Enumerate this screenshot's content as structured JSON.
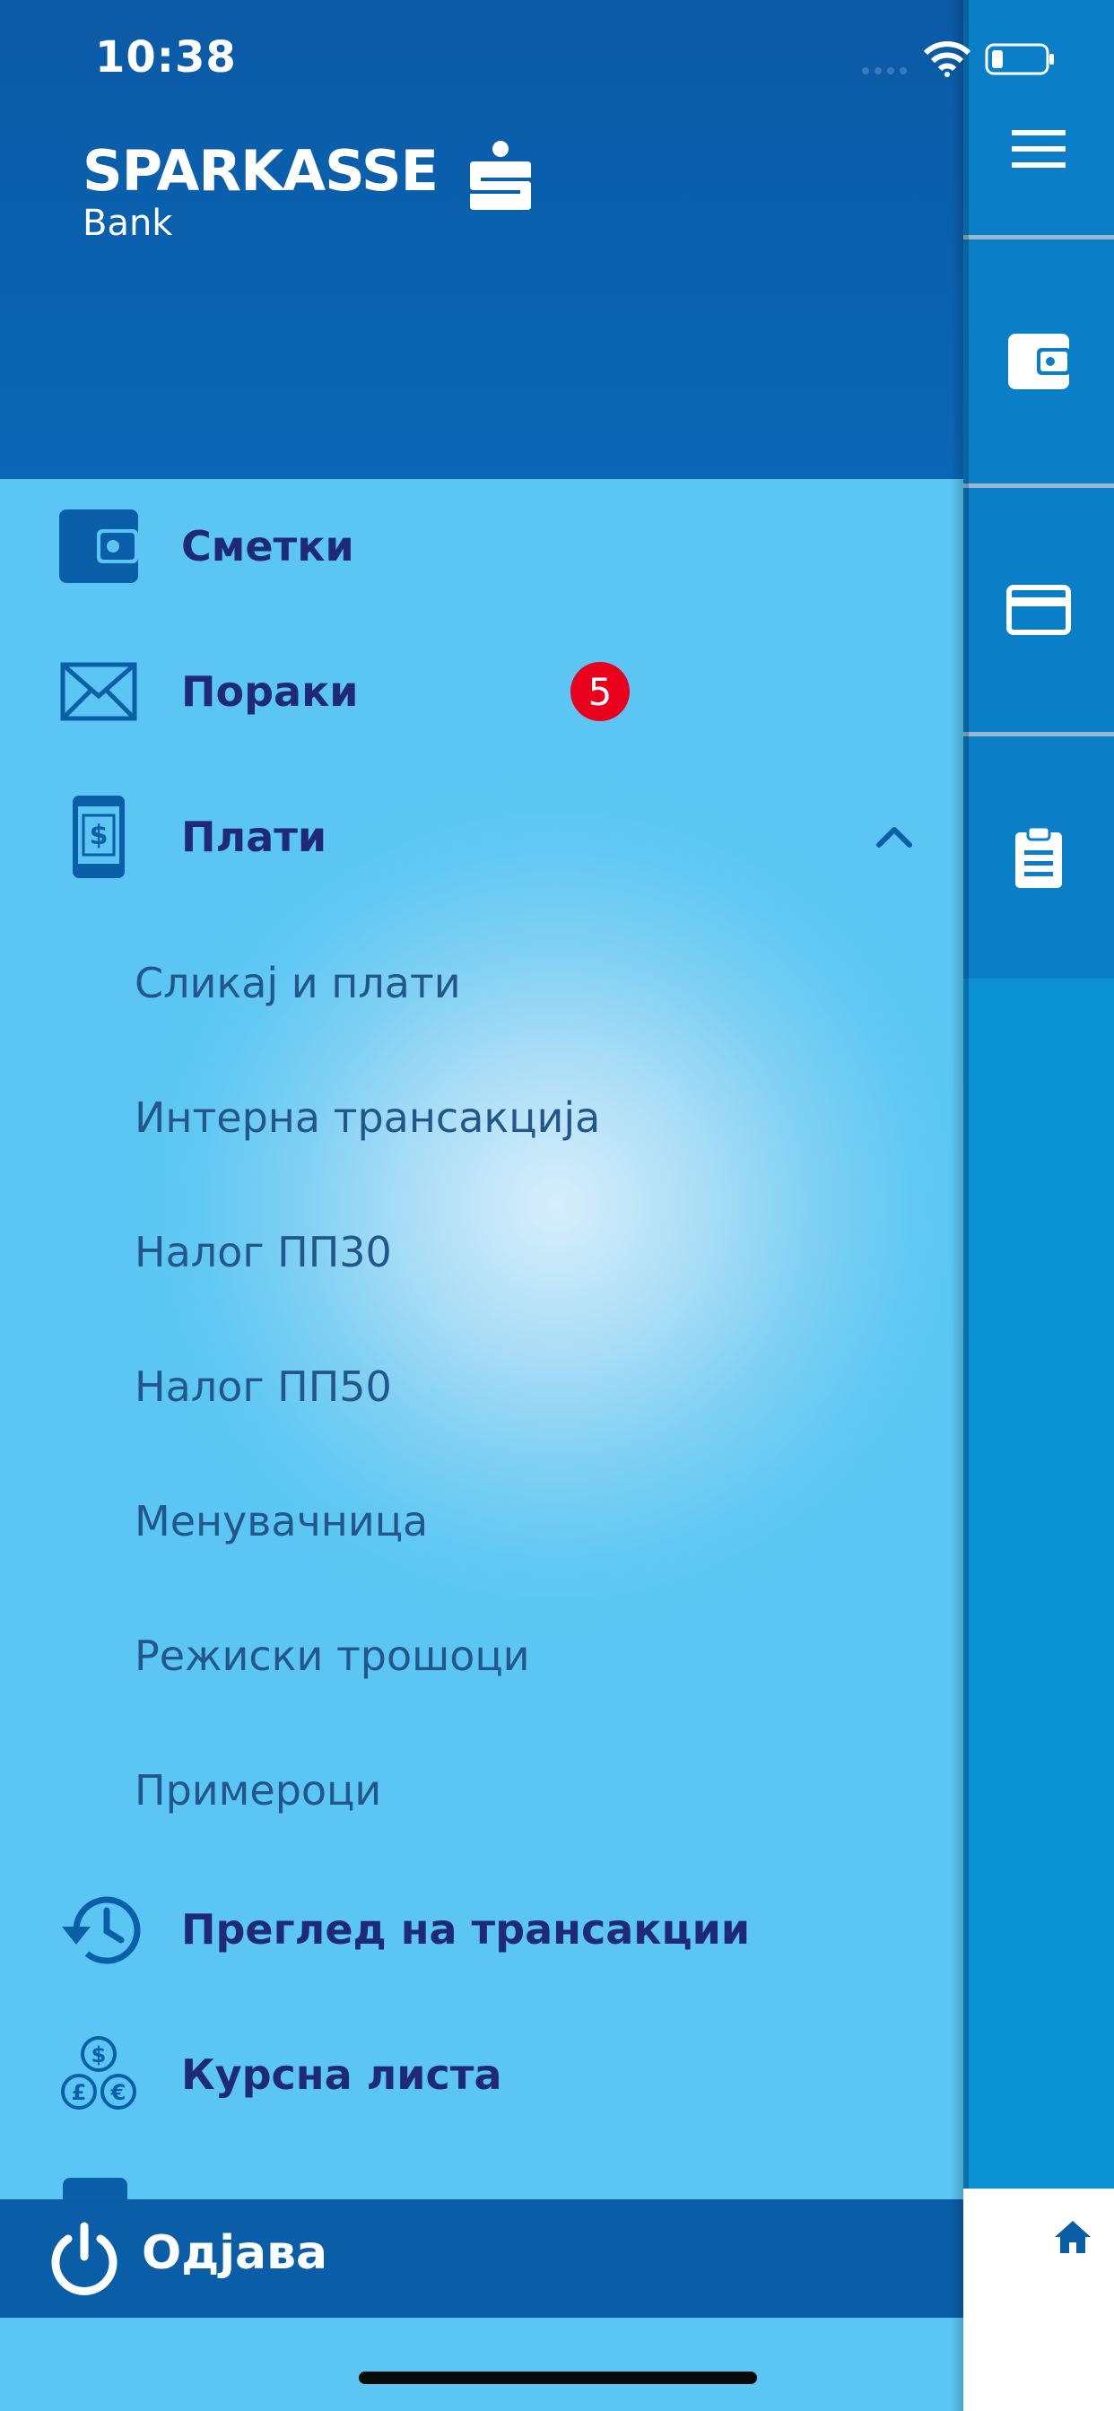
{
  "status": {
    "time": "10:38"
  },
  "brand": {
    "name": "SPARKASSE",
    "sub": "Bank"
  },
  "menu": {
    "items": [
      {
        "label": "Сметки",
        "icon": "wallet-icon"
      },
      {
        "label": "Пораки",
        "icon": "envelope-icon",
        "badge": "5"
      },
      {
        "label": "Плати",
        "icon": "mobile-payment-icon",
        "expanded": true
      }
    ],
    "sub_items": [
      "Сликај и плати",
      "Интерна трансакција",
      "Налог ПП30",
      "Налог ПП50",
      "Менувачница",
      "Режиски трошоци",
      "Примероци"
    ],
    "more_items": [
      {
        "label": "Преглед на трансакции",
        "icon": "history-icon"
      },
      {
        "label": "Курсна листа",
        "icon": "currency-coins-icon"
      }
    ]
  },
  "logout": {
    "label": "Одјава",
    "icon": "power-icon"
  },
  "rail": {
    "buttons": [
      "hamburger-menu-icon",
      "wallet-icon",
      "credit-card-icon",
      "clipboard-icon"
    ],
    "home_icon": "home-icon"
  },
  "colors": {
    "header_blue": "#0b5aa6",
    "menu_cyan": "#5bc6f3",
    "label_navy": "#1e2a78",
    "badge_red": "#e8001c",
    "rail_blue": "#0a7fc8"
  }
}
